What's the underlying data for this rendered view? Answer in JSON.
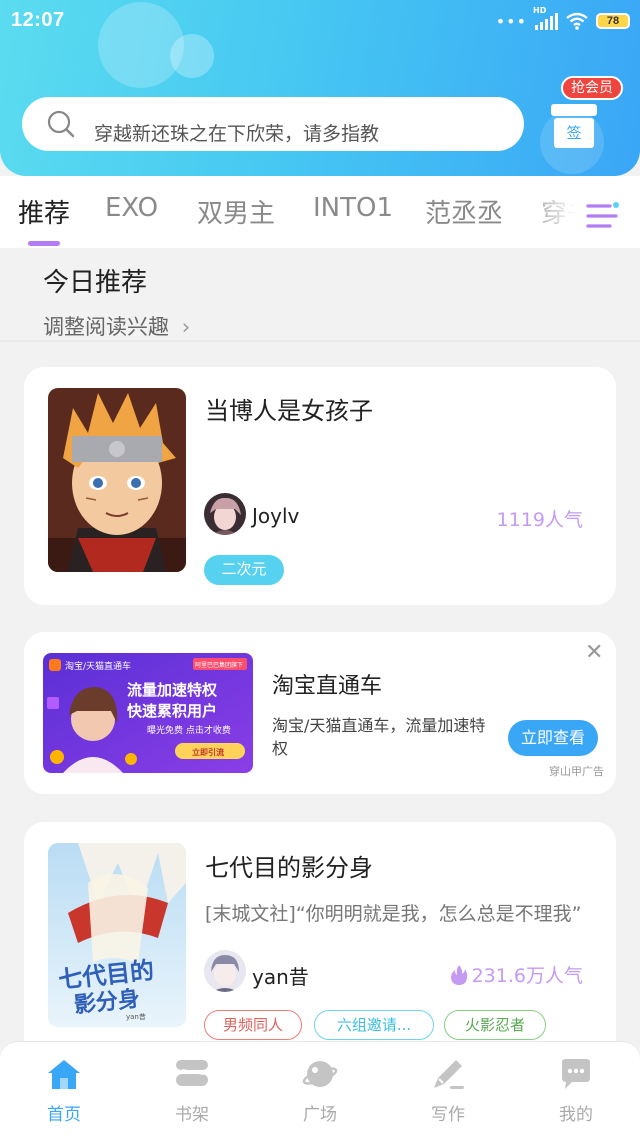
{
  "status_bar": {
    "time": "12:07",
    "network": "HD",
    "battery": "78"
  },
  "search": {
    "placeholder": "穿越新还珠之在下欣荣，请多指教"
  },
  "vip": {
    "badge": "抢会员",
    "sign_in": "签"
  },
  "tabs": [
    {
      "label": "推荐",
      "active": true
    },
    {
      "label": "EXO",
      "active": false
    },
    {
      "label": "双男主",
      "active": false
    },
    {
      "label": "INTO1",
      "active": false
    },
    {
      "label": "范丞丞",
      "active": false
    },
    {
      "label": "穿书",
      "active": false
    }
  ],
  "section": {
    "title": "今日推荐",
    "subtitle": "调整阅读兴趣"
  },
  "books": [
    {
      "title": "当博人是女孩子",
      "author": "Joylv",
      "popularity": "1119人气",
      "tags": [
        {
          "label": "二次元",
          "style": "filled-cyan"
        }
      ]
    },
    {
      "title": "七代目的影分身",
      "description": "[末城文社]“你明明就是我，怎么总是不理我”",
      "author": "yan昔",
      "popularity": "231.6万人气",
      "cover_title": "七代目的影分身",
      "cover_author": "yan昔",
      "tags": [
        {
          "label": "男频同人",
          "style": "outline-red"
        },
        {
          "label": "六组邀请...",
          "style": "outline-cyan"
        },
        {
          "label": "火影忍者",
          "style": "outline-green"
        }
      ]
    }
  ],
  "ad": {
    "title": "淘宝直通车",
    "description": "淘宝/天猫直通车，流量加速特权",
    "button": "立即查看",
    "source": "穿山甲广告",
    "image_brand": "淘宝/天猫直通车",
    "image_corner": "阿里巴巴集团旗下",
    "image_line1": "流量加速特权",
    "image_line2": "快速累积用户",
    "image_line3": "曝光免费 点击才收费",
    "image_button": "立即引流"
  },
  "bottom_nav": [
    {
      "label": "首页",
      "icon": "home-icon",
      "active": true
    },
    {
      "label": "书架",
      "icon": "bookshelf-icon",
      "active": false
    },
    {
      "label": "广场",
      "icon": "planet-icon",
      "active": false
    },
    {
      "label": "写作",
      "icon": "pen-icon",
      "active": false
    },
    {
      "label": "我的",
      "icon": "chat-bubble-icon",
      "active": false
    }
  ],
  "colors": {
    "accent": "#3aa6f6",
    "tab_indicator": "#b27cf5",
    "popularity": "#c59af3",
    "vip_red": "#f0453e"
  }
}
